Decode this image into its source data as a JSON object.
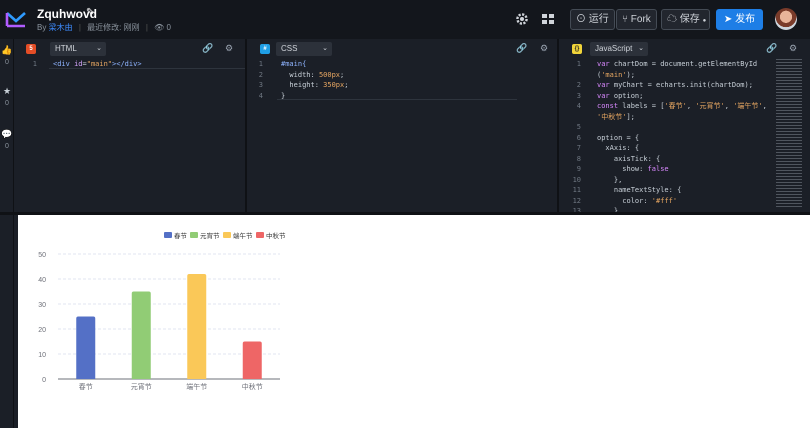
{
  "header": {
    "title": "Zquhwovd",
    "author_prefix": "By",
    "author": "梁木由",
    "last_modified": "最近修改: 刚刚",
    "views": "0",
    "run_label": "运行",
    "fork_label": "Fork",
    "save_label": "保存",
    "publish_label": "发布"
  },
  "rail": {
    "like_count": "0",
    "star_count": "0",
    "comment_count": "0"
  },
  "html_pane": {
    "badge": "5",
    "lang": "HTML",
    "lines": [
      "1"
    ],
    "code_parts": [
      "<div ",
      "id",
      "=",
      "\"main\"",
      "></div>"
    ]
  },
  "css_pane": {
    "badge": "#",
    "lang": "CSS",
    "lines": [
      "1",
      "2",
      "3",
      "4"
    ],
    "code": {
      "l1": "#main{",
      "l2a": "  width: ",
      "l2b": "500px",
      "l2c": ";",
      "l3a": "  height: ",
      "l3b": "350px",
      "l3c": ";",
      "l4": "}"
    }
  },
  "js_pane": {
    "badge": "{}",
    "lang": "JavaScript",
    "lines": [
      "1",
      "",
      "2",
      "3",
      "4",
      "",
      "5",
      "6",
      "7",
      "8",
      "9",
      "10",
      "11",
      "12",
      "13"
    ],
    "code": [
      [
        "kw",
        "var "
      ],
      [
        "p",
        "chartDom = document.getElementById"
      ],
      [
        "p",
        "("
      ],
      [
        "str",
        "'main'"
      ],
      [
        "p",
        ");"
      ],
      [
        "kw",
        "var "
      ],
      [
        "p",
        "myChart = echarts.init(chartDom);"
      ],
      [
        "kw",
        "var "
      ],
      [
        "p",
        "option;"
      ],
      [
        "kw",
        "const "
      ],
      [
        "p",
        "labels = ["
      ],
      [
        "str",
        "'春节'"
      ],
      [
        "p",
        ", "
      ],
      [
        "str",
        "'元宵节'"
      ],
      [
        "p",
        ", "
      ],
      [
        "str",
        "'端午节'"
      ],
      [
        "p",
        ","
      ],
      [
        "str",
        "'中秋节'"
      ],
      [
        "p",
        "];"
      ],
      [
        "p",
        "option = {"
      ],
      [
        "p",
        "  xAxis: {"
      ],
      [
        "p",
        "    axisTick: {"
      ],
      [
        "p",
        "      show: "
      ],
      [
        "kw",
        "false"
      ],
      [
        "p",
        "    },"
      ],
      [
        "p",
        "    nameTextStyle: {"
      ],
      [
        "p",
        "      color: "
      ],
      [
        "str",
        "'#fff'"
      ],
      [
        "p",
        "    },"
      ]
    ]
  },
  "colors": {
    "accent": "#1e7ee6",
    "editor_bg": "#1b1f27",
    "topbar_bg": "#13161c"
  },
  "icons": {
    "logo": "codepen-like-logo-icon",
    "settings": "gear-icon",
    "layout": "grid-layout-icon",
    "run": "play-circle-icon",
    "fork": "fork-icon",
    "save": "cloud-save-icon",
    "publish": "paper-plane-icon"
  },
  "chart_data": {
    "type": "bar",
    "categories": [
      "春节",
      "元宵节",
      "端午节",
      "中秋节"
    ],
    "values": [
      25,
      35,
      42,
      15
    ],
    "colors": [
      "#5470c6",
      "#91cc75",
      "#fac858",
      "#ee6666"
    ],
    "ylim": [
      0,
      50
    ],
    "yticks": [
      "0",
      "10",
      "20",
      "30",
      "40",
      "50"
    ],
    "legend": [
      "春节",
      "元宵节",
      "端午节",
      "中秋节"
    ],
    "legend_position": "top-center",
    "grid": true
  }
}
